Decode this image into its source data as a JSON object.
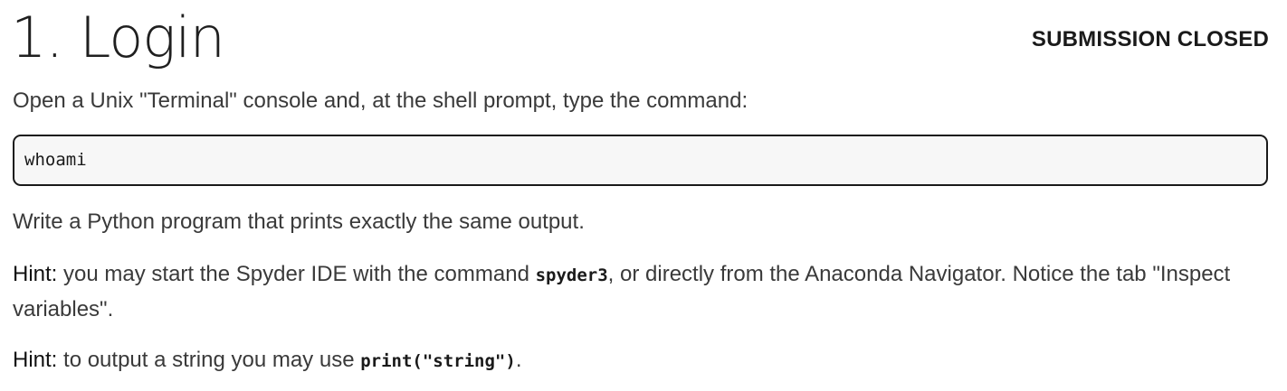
{
  "header": {
    "title": "1. Login",
    "status": "SUBMISSION CLOSED"
  },
  "intro": "Open a Unix \"Terminal\" console and, at the shell prompt, type the command:",
  "command": "whoami",
  "task": "Write a Python program that prints exactly the same output.",
  "hints": [
    {
      "label": "Hint:",
      "before": " you may start the Spyder IDE with the command ",
      "code": "spyder3",
      "after": ", or directly from the Anaconda Navigator. Notice the tab \"Inspect variables\"."
    },
    {
      "label": "Hint:",
      "before": " to output a string you may use ",
      "code": "print(\"string\")",
      "after": "."
    }
  ]
}
